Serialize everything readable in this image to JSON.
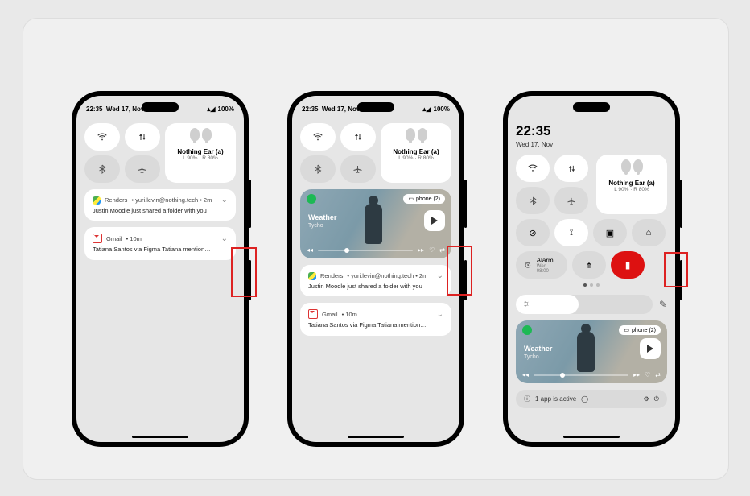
{
  "status": {
    "time": "22:35",
    "date": "Wed 17, Nov",
    "battery": "100%"
  },
  "media_widget": {
    "title": "Nothing Ear (a)",
    "sub": "L 90% · R 80%"
  },
  "now_playing": {
    "badge": "phone (2)",
    "title": "Weather",
    "artist": "Tycho"
  },
  "notifications": [
    {
      "app": "Renders",
      "meta": "• yuri.levin@nothing.tech • 2m",
      "body": "Justin Moodle just shared a folder with you"
    },
    {
      "app": "Gmail",
      "meta": "• 10m",
      "body": "Tatiana Santos via Figma Tatiana mention…"
    }
  ],
  "phone3": {
    "clock": "22:35",
    "date": "Wed 17, Nov",
    "alarm_label": "Alarm",
    "alarm_time": "Wed 08:00",
    "footer": "1 app is active"
  },
  "icons": {
    "wifi": "wifi",
    "data": "data",
    "bt": "bluetooth",
    "plane": "airplane",
    "dnd": "dnd",
    "loc": "location",
    "cast": "cast",
    "game": "game",
    "connect": "connect",
    "torch": "flashlight",
    "sun": "brightness",
    "edit": "edit",
    "info": "info",
    "user": "user",
    "power": "power",
    "gear": "settings"
  }
}
